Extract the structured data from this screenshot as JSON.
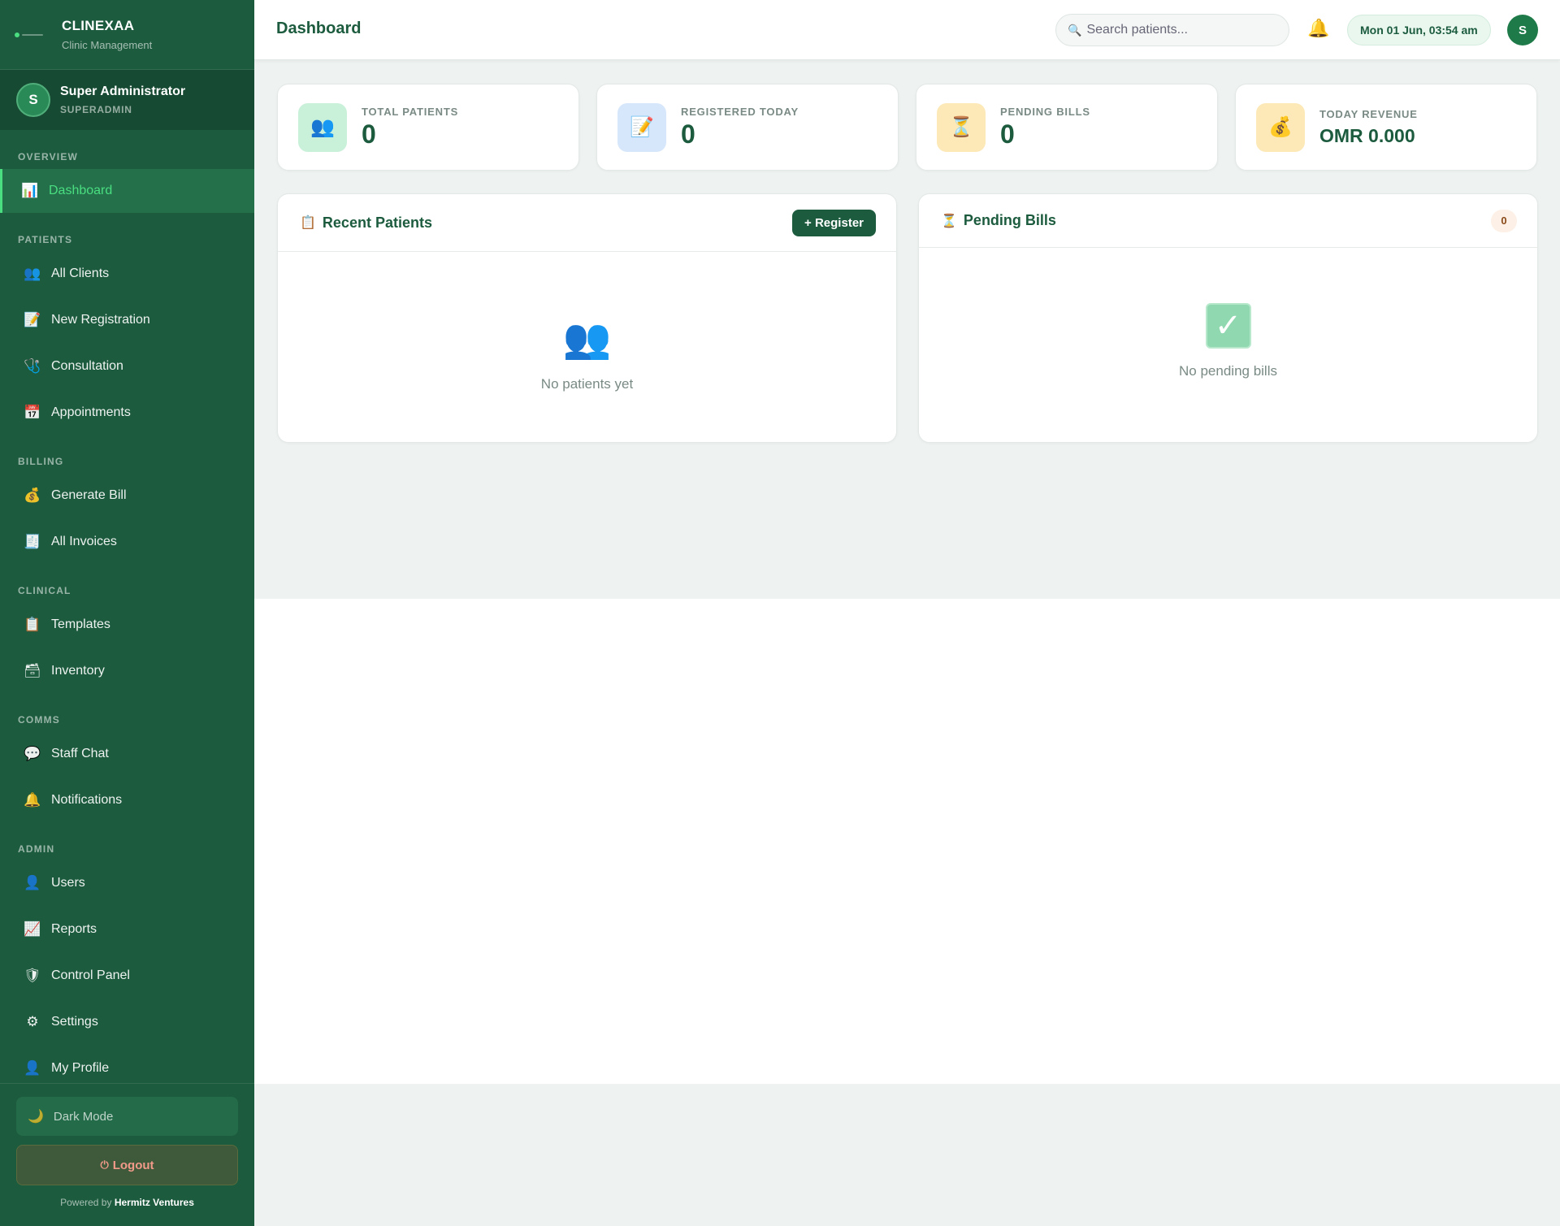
{
  "brand": {
    "name": "CLINEXAA",
    "subtitle": "Clinic Management"
  },
  "user": {
    "initial": "S",
    "name": "Super Administrator",
    "role": "SUPERADMIN"
  },
  "nav": {
    "sections": {
      "overview": "OVERVIEW",
      "patients": "PATIENTS",
      "billing": "BILLING",
      "clinical": "CLINICAL",
      "comms": "COMMS",
      "admin": "ADMIN"
    },
    "items": {
      "dashboard": {
        "label": "Dashboard",
        "icon": "bar-chart-icon"
      },
      "all_clients": {
        "label": "All Clients",
        "icon": "users-icon"
      },
      "new_registration": {
        "label": "New Registration",
        "icon": "memo-icon"
      },
      "consultation": {
        "label": "Consultation",
        "icon": "stethoscope-icon"
      },
      "appointments": {
        "label": "Appointments",
        "icon": "calendar-icon"
      },
      "generate_bill": {
        "label": "Generate Bill",
        "icon": "money-bag-icon"
      },
      "all_invoices": {
        "label": "All Invoices",
        "icon": "receipt-icon"
      },
      "templates": {
        "label": "Templates",
        "icon": "clipboard-icon"
      },
      "inventory": {
        "label": "Inventory",
        "icon": "box-icon"
      },
      "staff_chat": {
        "label": "Staff Chat",
        "icon": "chat-bubble-icon"
      },
      "notifications": {
        "label": "Notifications",
        "icon": "bell-icon"
      },
      "users": {
        "label": "Users",
        "icon": "user-icon"
      },
      "reports": {
        "label": "Reports",
        "icon": "trend-chart-icon"
      },
      "control_panel": {
        "label": "Control Panel",
        "icon": "shield-icon"
      },
      "settings": {
        "label": "Settings",
        "icon": "gear-icon"
      },
      "my_profile": {
        "label": "My Profile",
        "icon": "user-icon"
      }
    }
  },
  "bottom": {
    "dark_mode": "Dark Mode",
    "logout": "Logout",
    "powered_prefix": "Powered by",
    "powered_by": "Hermitz Ventures"
  },
  "topbar": {
    "title": "Dashboard",
    "search_placeholder": "Search patients...",
    "datetime": "Mon 01 Jun, 03:54 am",
    "avatar_initial": "S"
  },
  "stats": [
    {
      "label": "TOTAL PATIENTS",
      "value": "0",
      "icon": "users-icon",
      "color": "#c9f0d9"
    },
    {
      "label": "REGISTERED TODAY",
      "value": "0",
      "icon": "memo-icon",
      "color": "#d6e6fb"
    },
    {
      "label": "PENDING BILLS",
      "value": "0",
      "icon": "hourglass-icon",
      "color": "#fde9b8"
    },
    {
      "label": "TODAY REVENUE",
      "value": "OMR 0.000",
      "icon": "money-bag-icon",
      "color": "#fde9b8"
    }
  ],
  "recent_patients": {
    "title": "Recent Patients",
    "register_button": "+ Register",
    "empty_text": "No patients yet"
  },
  "pending_bills": {
    "title": "Pending Bills",
    "count": "0",
    "empty_text": "No pending bills"
  },
  "colors": {
    "sidebar": "#1c5b3e",
    "accent": "#4ade80",
    "background": "#eef2f0"
  }
}
